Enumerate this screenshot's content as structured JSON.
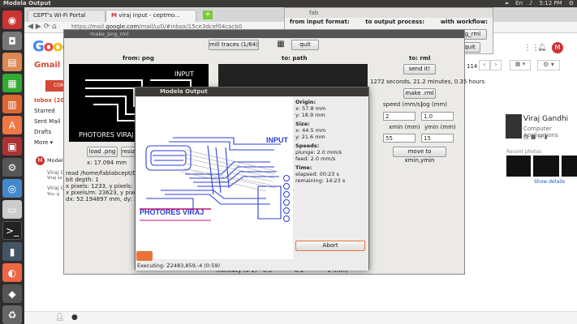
{
  "topbar": {
    "title": "Modela Output",
    "time": "5:12 PM"
  },
  "browser": {
    "tabs": [
      "CEPT's Wi-Fi Portal",
      "viraj input - ceptmo..."
    ],
    "url_prefix": "https://mail.",
    "url_domain": "google.com",
    "url_rest": "/mail/u/0/#inbox/15ce3dcef04cacb0"
  },
  "gmail": {
    "logo": "Google",
    "label": "Gmail",
    "compose": "COMPOSE",
    "nav": [
      "Inbox (20)",
      "Starred",
      "Sent Mail",
      "Drafts",
      "More"
    ],
    "hangout_name": "Modela",
    "hangout_items": [
      "Viraj G",
      "Viraj G",
      "You: g"
    ],
    "hangout_sub": "Viraj sa",
    "counter": "114",
    "profile_name": "Viraj Gandhi",
    "profile_role": "Computer Applications",
    "recent_photos": "Recent photos",
    "show_details": "Show details",
    "avatar_letter": "M"
  },
  "fab": {
    "title": "fab",
    "col1": "from input format:",
    "col2": "to output process:",
    "col3": "with workflow:",
    "workflow_value": "png_rml",
    "quit": "quit"
  },
  "mpr": {
    "title": "make_png_rml",
    "mode": "mill traces (1/64)",
    "quit": "quit",
    "from_png": "from: png",
    "to_path": "to: path",
    "to_rml": "to: rml",
    "send_it": "send it!",
    "time_info": "1272 seconds, 21.2 minutes, 0.35 hours",
    "make_rml": "make .rml",
    "speed_lbl": "speed (mm/s)",
    "jog_lbl": "jog (mm)",
    "speed_val": "2",
    "jog_val": "1.0",
    "xmin_lbl": "xmin (mm)",
    "ymin_lbl": "ymin (mm)",
    "xmin_val": "55",
    "ymin_val": "15",
    "move_btn": "move to xmin,ymin",
    "load_png": "load .png",
    "resize": "resize",
    "x_info": "x: 17.094 mm",
    "read_info": "read /home/fablabcept/Dow",
    "bit_depth": "bit depth: 1",
    "x_pixels": "x pixels: 1233, y pixels: 682",
    "x_pixels_m": "x pixels/m: 23623, y pixels/m",
    "dx_info": "dx: 52.194897 mm, dy: 28.87",
    "intensity": "intensity (0-1)",
    "intensity_val": "0.5",
    "bottom_val": "0.1",
    "depth": "z (mm)",
    "preview_input": "INPUT",
    "preview_photores": "PHOTORES VIRAJ"
  },
  "modela": {
    "title": "Modela Output",
    "origin_lbl": "Origin:",
    "origin_x": "x: 57.8 mm",
    "origin_y": "y: 18.9 mm",
    "size_lbl": "Size:",
    "size_x": "x: 44.5 mm",
    "size_y": "y: 21.6 mm",
    "speeds_lbl": "Speeds:",
    "plunge": "plunge: 2.0 mm/s",
    "feed": "feed: 2.0 mm/s",
    "time_lbl": "Time:",
    "elapsed": "elapsed: 00:23 s",
    "remaining": "remaining: 14:23 s",
    "abort": "Abort",
    "executing": "Executing: Z2483,859,-4 (0:59)",
    "canvas_input": "INPUT",
    "canvas_photores": "PHOTORES VIRAJ",
    "progress_fraction": 0.03
  }
}
